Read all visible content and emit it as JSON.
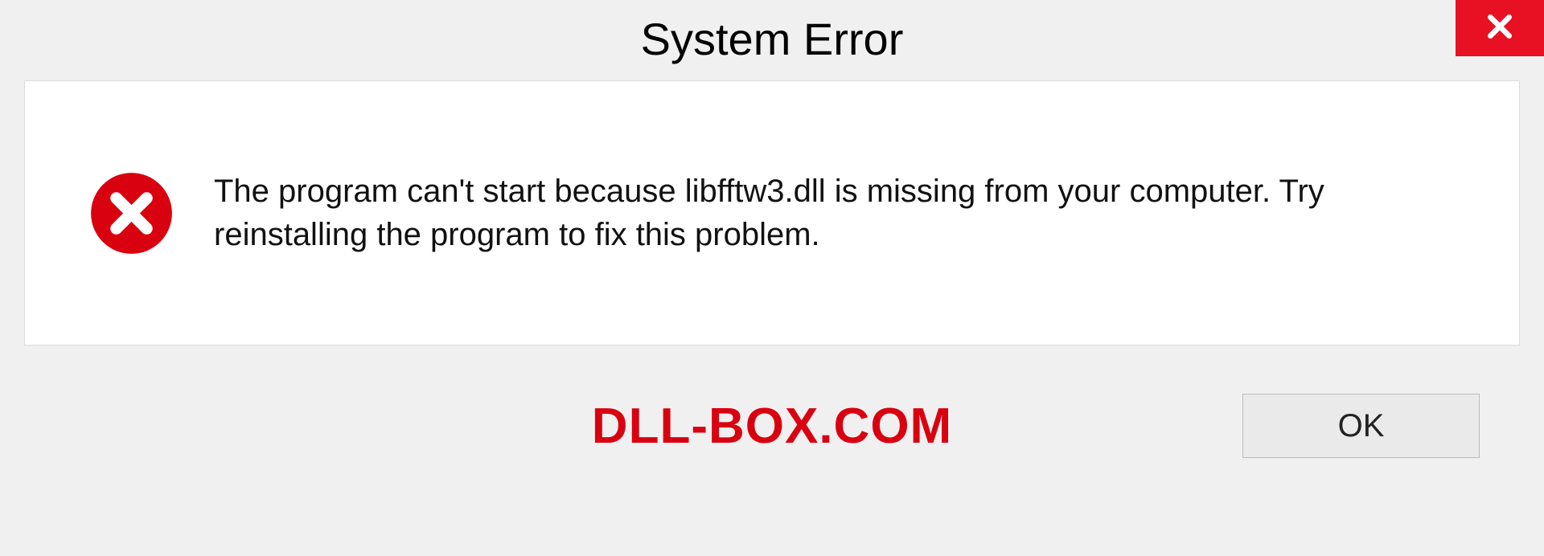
{
  "title": "System Error",
  "message": "The program can't start because libfftw3.dll is missing from your computer. Try reinstalling the program to fix this problem.",
  "ok_label": "OK",
  "watermark": "DLL-BOX.COM",
  "colors": {
    "close": "#e81123",
    "error": "#d90010"
  }
}
